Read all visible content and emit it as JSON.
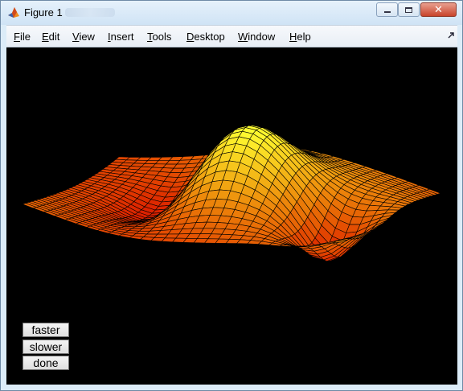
{
  "window": {
    "title": "Figure 1"
  },
  "menu": {
    "items": [
      {
        "underline": "F",
        "rest": "ile"
      },
      {
        "underline": "E",
        "rest": "dit"
      },
      {
        "underline": "V",
        "rest": "iew"
      },
      {
        "underline": "I",
        "rest": "nsert"
      },
      {
        "underline": "T",
        "rest": "ools"
      },
      {
        "underline": "D",
        "rest": "esktop"
      },
      {
        "underline": "W",
        "rest": "indow"
      },
      {
        "underline": "H",
        "rest": "elp"
      }
    ]
  },
  "controls": {
    "faster_label": "faster",
    "slower_label": "slower",
    "done_label": "done"
  },
  "icons": {
    "app": "matlab-membrane-icon",
    "minimize": "minimize-icon",
    "maximize": "maximize-icon",
    "close": "close-icon",
    "dock": "dock-arrow-icon"
  },
  "colors": {
    "canvas_background": "#000000",
    "surface_low": "#e02000",
    "surface_high": "#ffff30",
    "mesh_lines": "#000000"
  }
}
